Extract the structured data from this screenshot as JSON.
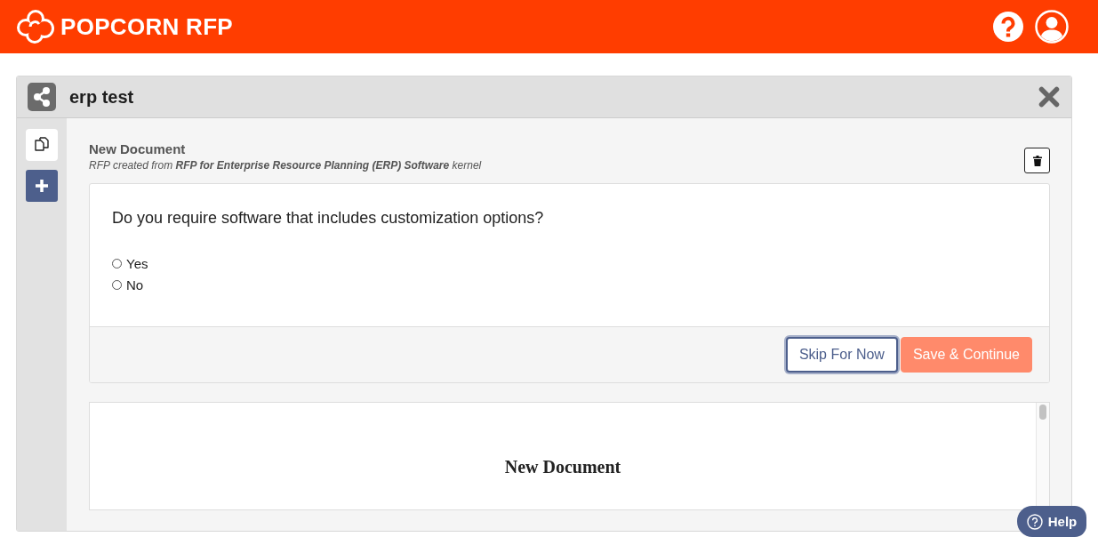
{
  "header": {
    "brand": "POPCORN RFP"
  },
  "panel": {
    "title": "erp test"
  },
  "document": {
    "title": "New Document",
    "subtitle": "RFP created from **RFP for Enterprise Resource Planning (ERP) Software** kernel"
  },
  "question": {
    "text": "Do you require software that includes customization options?",
    "options": [
      {
        "label": "Yes",
        "selected": false
      },
      {
        "label": "No",
        "selected": false
      }
    ]
  },
  "actions": [
    {
      "label": "Skip For Now",
      "kind": "secondary",
      "focused": true
    },
    {
      "label": "Save & Continue",
      "kind": "primary",
      "focused": false
    }
  ],
  "preview": {
    "heading": "New Document"
  },
  "help_button": {
    "label": "Help"
  }
}
